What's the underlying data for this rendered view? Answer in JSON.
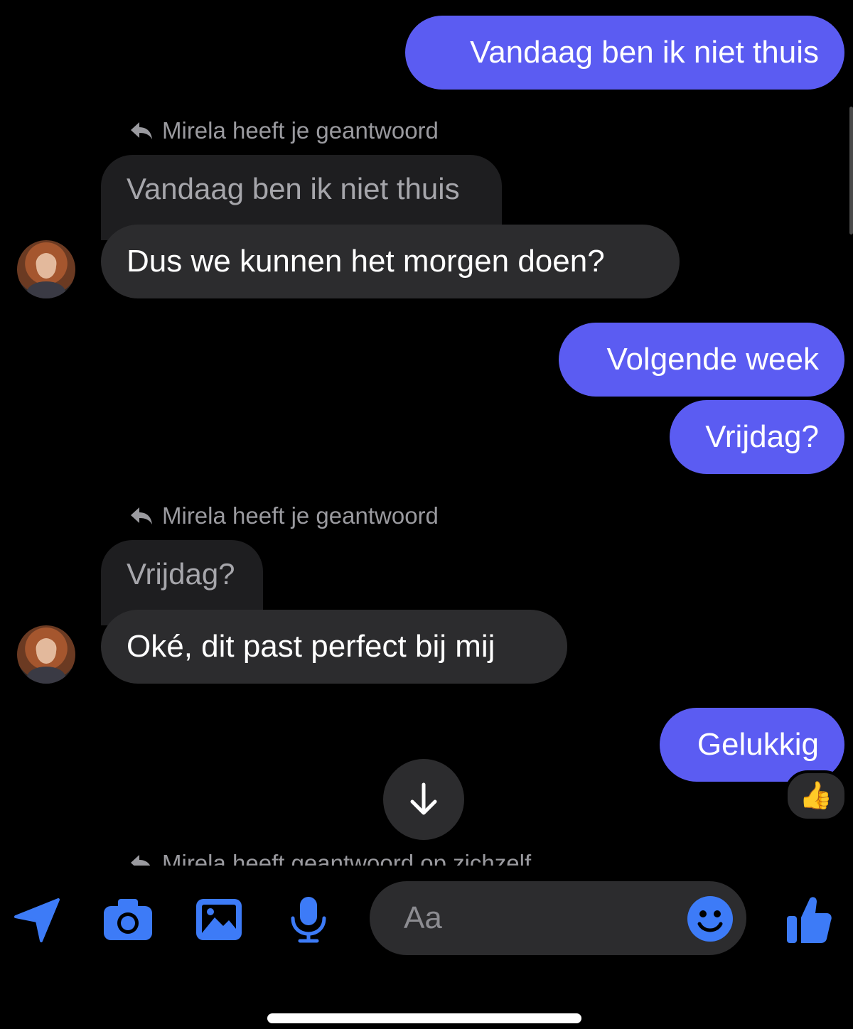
{
  "colors": {
    "outgoing_bubble": "#5b5cf2",
    "incoming_bubble": "#2c2c2e",
    "quoted_bubble": "#1e1e20",
    "accent_icon": "#3d7bf7",
    "background": "#000000"
  },
  "messages": [
    {
      "direction": "out",
      "text": "Vandaag ben ik niet thuis"
    },
    {
      "direction": "in",
      "reply_note": "Mirela heeft je geantwoord",
      "quoted": "Vandaag ben ik niet thuis",
      "text": "Dus we kunnen het morgen doen?"
    },
    {
      "direction": "out",
      "text": "Volgende week"
    },
    {
      "direction": "out",
      "text": "Vrijdag?"
    },
    {
      "direction": "in",
      "reply_note": "Mirela heeft je geantwoord",
      "quoted": "Vrijdag?",
      "text": "Oké, dit past perfect bij mij"
    },
    {
      "direction": "out",
      "text": "Gelukkig",
      "reaction": "👍"
    }
  ],
  "cutoff_reply_note": "Mirela heeft geantwoord op zichzelf",
  "scroll_down_icon": "arrow-down-icon",
  "composer": {
    "placeholder": "Aa",
    "icons": [
      "send-location-icon",
      "camera-icon",
      "gallery-icon",
      "microphone-icon",
      "emoji-icon",
      "thumbs-up-icon"
    ]
  }
}
